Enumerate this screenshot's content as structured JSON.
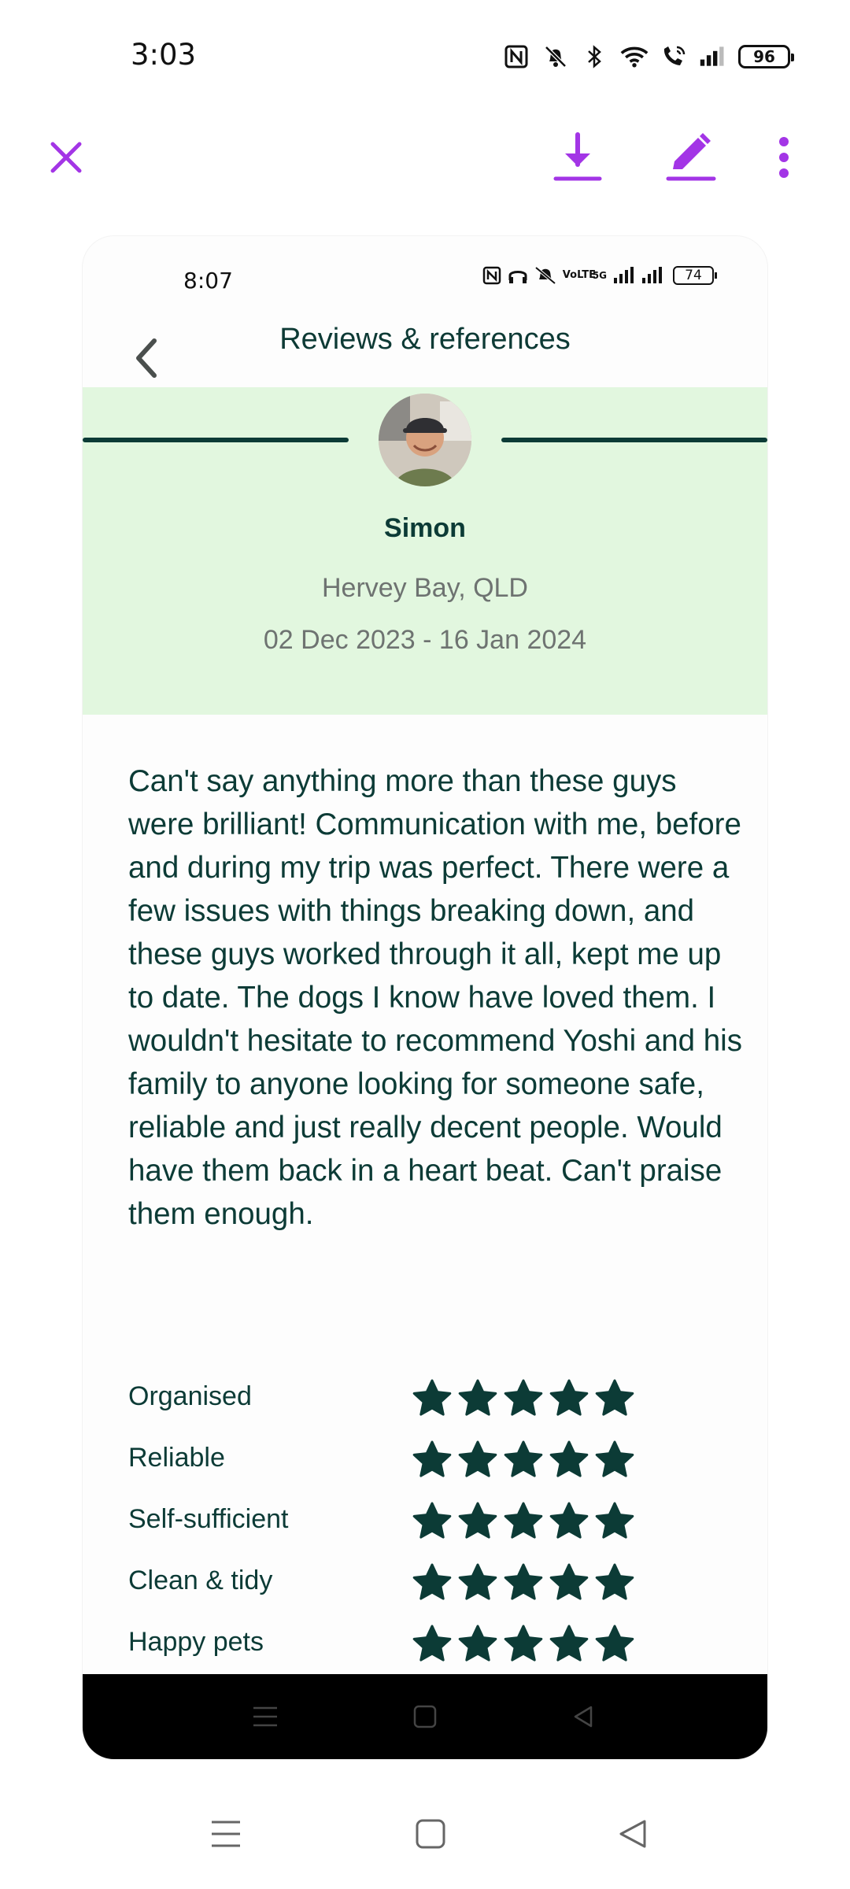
{
  "outer_status": {
    "time": "3:03",
    "battery": "96",
    "icons": [
      "nfc-icon",
      "bell-off-icon",
      "bluetooth-icon",
      "wifi-icon",
      "wifi-calling-icon",
      "signal-icon"
    ]
  },
  "viewer_toolbar": {
    "icons": [
      "close-icon",
      "download-icon",
      "edit-icon",
      "more-vert-icon"
    ],
    "accent_color": "#a335e6"
  },
  "inner_status": {
    "time": "8:07",
    "icons_text": "VoLTE",
    "net": "5G",
    "battery": "74"
  },
  "header": {
    "title": "Reviews & references"
  },
  "profile": {
    "name": "Simon",
    "location": "Hervey Bay, QLD",
    "dates": "02 Dec 2023 - 16 Jan 2024",
    "band_color": "#e2f7df"
  },
  "review": {
    "text": "Can't say anything more than these guys were brilliant! Communication with me, before and during my trip was perfect. There were a few issues with things breaking down, and these guys worked through it all, kept me up to date. The dogs I know have loved them. I wouldn't hesitate to recommend Yoshi and his family to anyone looking for someone safe, reliable and just really decent people. Would have them back in a heart beat. Can't praise them enough."
  },
  "ratings": [
    {
      "label": "Organised",
      "stars": 5
    },
    {
      "label": "Reliable",
      "stars": 5
    },
    {
      "label": "Self-sufficient",
      "stars": 5
    },
    {
      "label": "Clean & tidy",
      "stars": 5
    },
    {
      "label": "Happy pets",
      "stars": 5
    }
  ],
  "nav": {
    "icons": [
      "menu-icon",
      "home-square-icon",
      "back-triangle-icon"
    ]
  }
}
